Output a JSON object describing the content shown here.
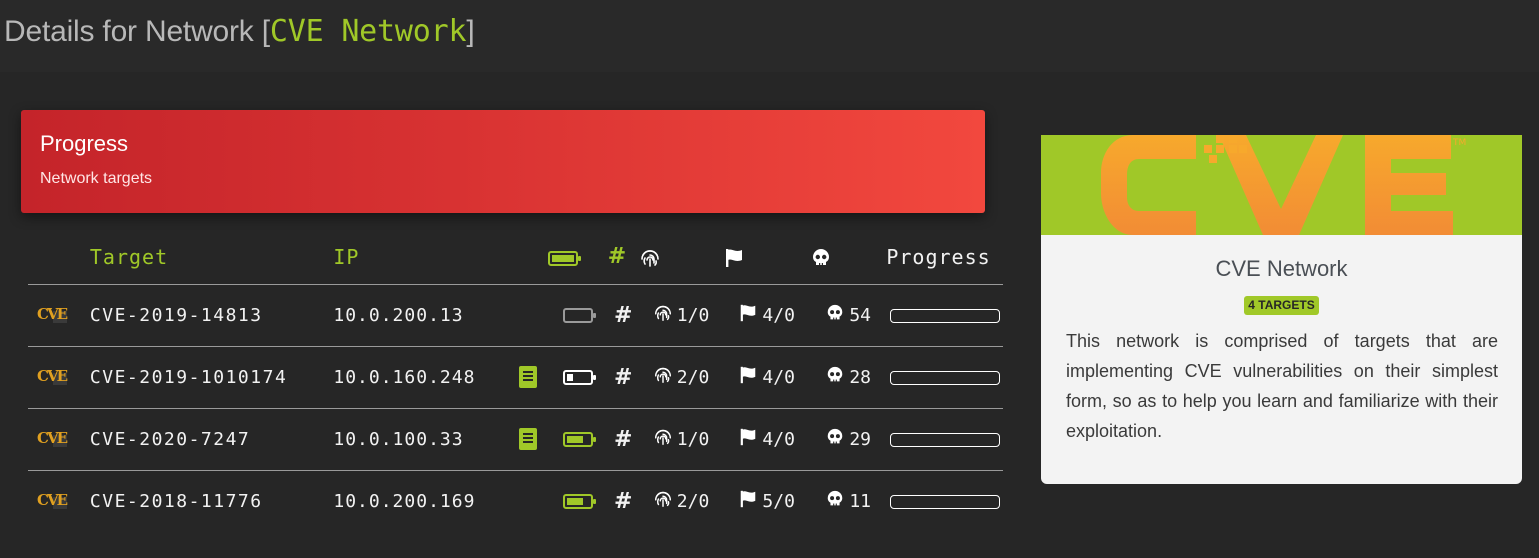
{
  "page": {
    "title_prefix": "Details for Network [",
    "network_name": "CVE Network",
    "title_suffix": "]"
  },
  "progress_card": {
    "title": "Progress",
    "subtitle": "Network targets"
  },
  "table": {
    "headers": {
      "target": "Target",
      "ip": "IP",
      "hash": "#",
      "progress": "Progress"
    },
    "rows": [
      {
        "logo": "CVE",
        "target": "CVE-2019-14813",
        "ip": "10.0.200.13",
        "has_writeup": false,
        "battery": "empty",
        "hash": "#",
        "fingerprints": "1/0",
        "flags": "4/0",
        "kills": "54",
        "progress": 0
      },
      {
        "logo": "CVE",
        "target": "CVE-2019-1010174",
        "ip": "10.0.160.248",
        "has_writeup": true,
        "battery": "low",
        "hash": "#",
        "fingerprints": "2/0",
        "flags": "4/0",
        "kills": "28",
        "progress": 0
      },
      {
        "logo": "CVE",
        "target": "CVE-2020-7247",
        "ip": "10.0.100.33",
        "has_writeup": true,
        "battery": "medium",
        "hash": "#",
        "fingerprints": "1/0",
        "flags": "4/0",
        "kills": "29",
        "progress": 0
      },
      {
        "logo": "CVE",
        "target": "CVE-2018-11776",
        "ip": "10.0.200.169",
        "has_writeup": false,
        "battery": "medium",
        "hash": "#",
        "fingerprints": "2/0",
        "flags": "5/0",
        "kills": "11",
        "progress": 0
      }
    ]
  },
  "side_card": {
    "banner_logo": "CVE",
    "name": "CVE Network",
    "badge": "4 TARGETS",
    "description": "This network is comprised of targets that are implementing CVE vulnerabilities on their simplest form, so as to help you learn and familiarize with their exploitation."
  },
  "colors": {
    "background": "#262626",
    "accent": "#a0c828",
    "header_gradient_start": "#c4242a",
    "header_gradient_end": "#f2483e",
    "logo_orange": "#f0a030"
  },
  "icons": {
    "battery": "battery-icon",
    "hash": "hash-icon",
    "fingerprint": "fingerprint-icon",
    "flag": "flag-icon",
    "skull": "skull-icon",
    "book": "book-icon"
  }
}
